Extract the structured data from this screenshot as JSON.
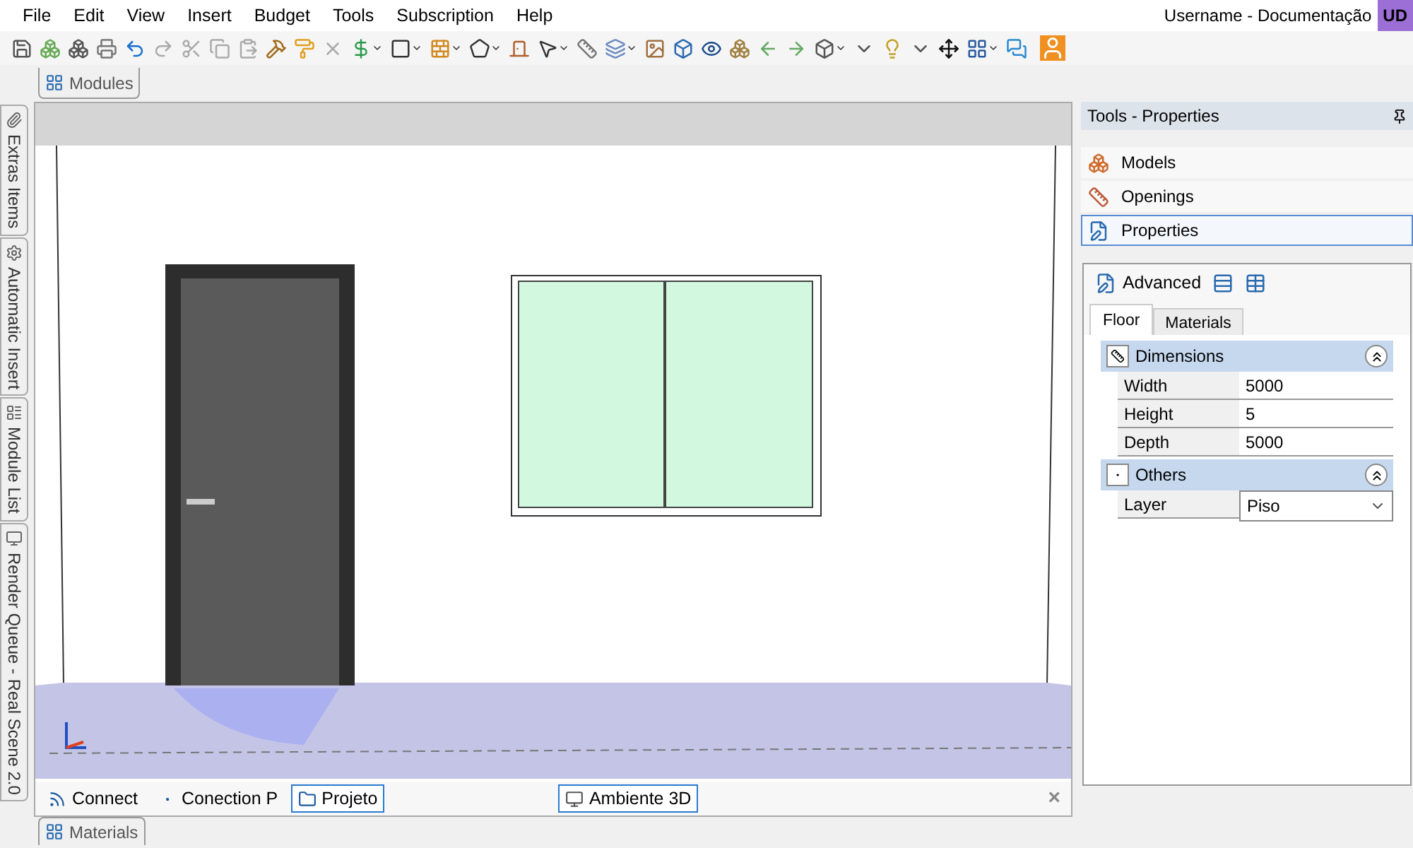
{
  "menu": [
    {
      "label": "File"
    },
    {
      "label": "Edit"
    },
    {
      "label": "View"
    },
    {
      "label": "Insert"
    },
    {
      "label": "Budget"
    },
    {
      "label": "Tools"
    },
    {
      "label": "Subscription"
    },
    {
      "label": "Help"
    }
  ],
  "user": {
    "name": "Username - Documentação",
    "initials": "UD"
  },
  "top_tabs": [
    {
      "label": "Modules"
    }
  ],
  "side_tabs": [
    {
      "label": "Extras Items",
      "kind": "clip"
    },
    {
      "label": "Automatic Insert",
      "kind": "gear"
    },
    {
      "label": "Module List",
      "kind": "list"
    },
    {
      "label": "Render Queue - Real Scene 2.0",
      "kind": "render"
    }
  ],
  "view_tabs_left": [
    {
      "label": "Connect",
      "kind": "rss",
      "selected": false
    },
    {
      "label": "Conection P",
      "kind": "p",
      "selected": false
    },
    {
      "label": "Projeto",
      "kind": "folder",
      "selected": true
    }
  ],
  "view_tabs_right": [
    {
      "label": "Ambiente 3D",
      "kind": "scene",
      "selected": true
    }
  ],
  "close_glyph": "×",
  "panel": {
    "title": "Tools - Properties",
    "nav": [
      {
        "label": "Models",
        "kind": "models",
        "selected": false
      },
      {
        "label": "Openings",
        "kind": "openings",
        "selected": false
      },
      {
        "label": "Properties",
        "kind": "properties",
        "selected": true
      }
    ],
    "advanced": "Advanced",
    "tabs": [
      {
        "label": "Floor",
        "selected": true
      },
      {
        "label": "Materials",
        "selected": false
      }
    ],
    "groups": [
      {
        "title": "Dimensions",
        "kind": "dims",
        "expanded": true,
        "rows": [
          {
            "label": "Width",
            "value": "5000",
            "kind": "text"
          },
          {
            "label": "Height",
            "value": "5",
            "kind": "text"
          },
          {
            "label": "Depth",
            "value": "5000",
            "kind": "text"
          }
        ]
      },
      {
        "title": "Others",
        "kind": "etc",
        "expanded": true,
        "rows": [
          {
            "label": "Layer",
            "value": "Piso",
            "kind": "select"
          }
        ]
      }
    ]
  },
  "bottom_tabs": [
    {
      "label": "Materials"
    }
  ]
}
